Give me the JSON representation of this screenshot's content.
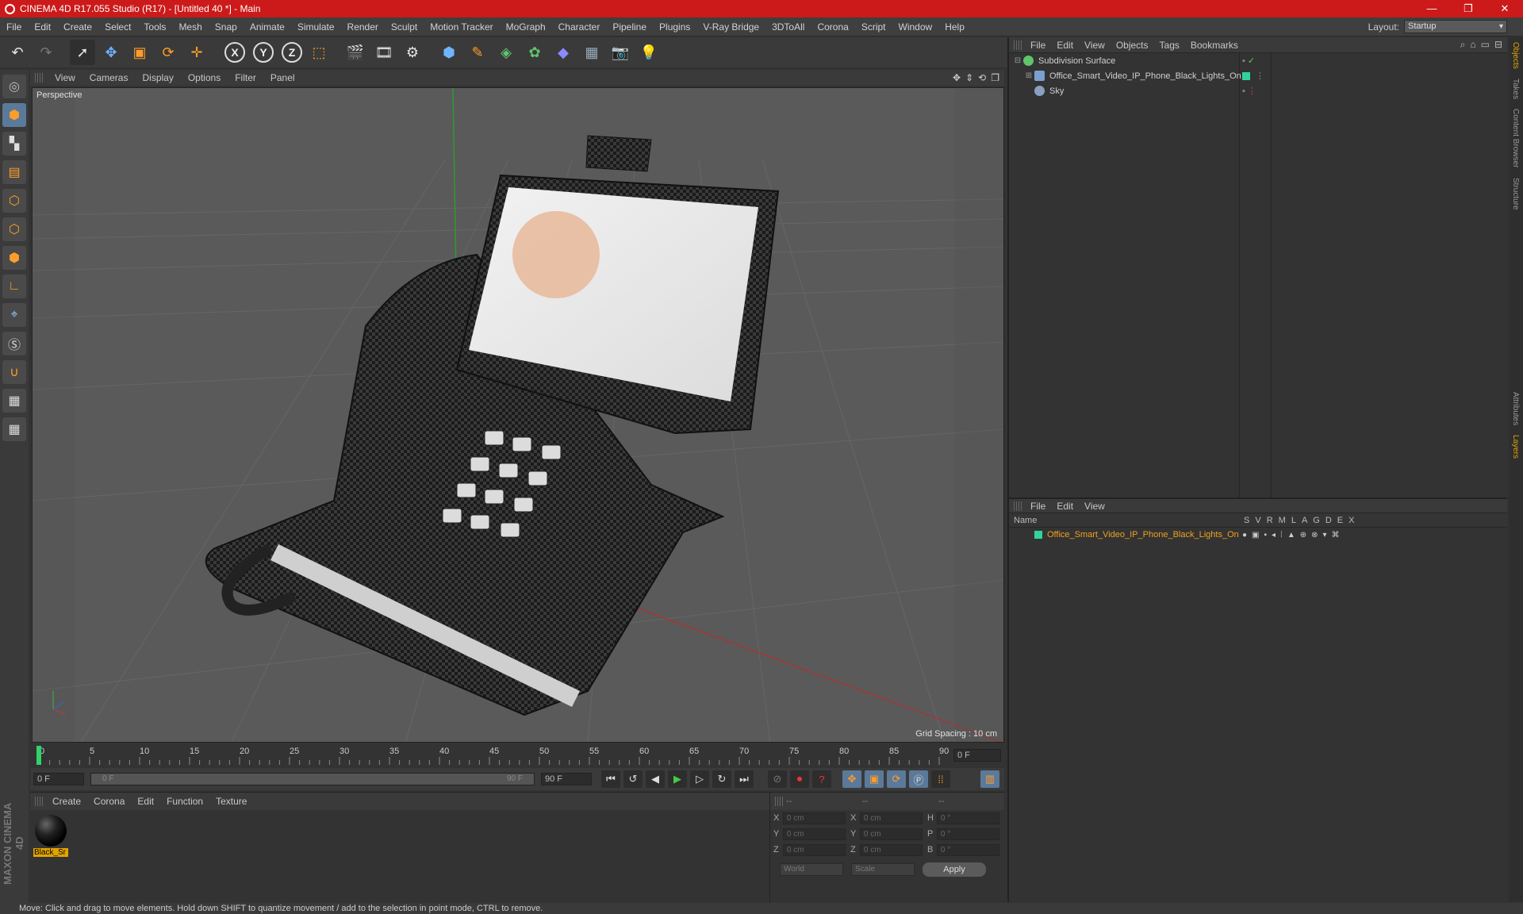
{
  "window": {
    "title": "CINEMA 4D R17.055 Studio (R17) - [Untitled 40 *] - Main",
    "controls": [
      "—",
      "❐",
      "✕"
    ]
  },
  "menu": [
    "File",
    "Edit",
    "Create",
    "Select",
    "Tools",
    "Mesh",
    "Snap",
    "Animate",
    "Simulate",
    "Render",
    "Sculpt",
    "Motion Tracker",
    "MoGraph",
    "Character",
    "Pipeline",
    "Plugins",
    "V-Ray Bridge",
    "3DToAll",
    "Corona",
    "Script",
    "Window",
    "Help"
  ],
  "layout": {
    "label": "Layout:",
    "value": "Startup"
  },
  "toolbar": {
    "axes": [
      "X",
      "Y",
      "Z"
    ]
  },
  "viewport": {
    "menu": [
      "View",
      "Cameras",
      "Display",
      "Options",
      "Filter",
      "Panel"
    ],
    "label": "Perspective",
    "grid_spacing": "Grid Spacing : 10 cm"
  },
  "timeline": {
    "ticks": [
      "0",
      "5",
      "10",
      "15",
      "20",
      "25",
      "30",
      "35",
      "40",
      "45",
      "50",
      "55",
      "60",
      "65",
      "70",
      "75",
      "80",
      "85",
      "90"
    ],
    "end_field": "0 F"
  },
  "transport": {
    "start": "0 F",
    "slider_left": "0 F",
    "slider_right": "90 F",
    "end": "90 F"
  },
  "materials": {
    "menu": [
      "Create",
      "Corona",
      "Edit",
      "Function",
      "Texture"
    ],
    "items": [
      {
        "name": "Black_Sr"
      }
    ]
  },
  "coords": {
    "header": [
      "--",
      "--",
      "--"
    ],
    "rows": [
      {
        "a": "X",
        "av": "0 cm",
        "b": "X",
        "bv": "0 cm",
        "c": "H",
        "cv": "0 °"
      },
      {
        "a": "Y",
        "av": "0 cm",
        "b": "Y",
        "bv": "0 cm",
        "c": "P",
        "cv": "0 °"
      },
      {
        "a": "Z",
        "av": "0 cm",
        "b": "Z",
        "bv": "0 cm",
        "c": "B",
        "cv": "0 °"
      }
    ],
    "world": "World",
    "scale": "Scale",
    "apply": "Apply"
  },
  "objects": {
    "menu": [
      "File",
      "Edit",
      "View",
      "Objects",
      "Tags",
      "Bookmarks"
    ],
    "items": [
      {
        "name": "Subdivision Surface",
        "color": "#5fc46a"
      },
      {
        "name": "Office_Smart_Video_IP_Phone_Black_Lights_On",
        "color": "#7aa0d0"
      },
      {
        "name": "Sky",
        "color": "#8aa0c0"
      }
    ]
  },
  "layers": {
    "menu": [
      "File",
      "Edit",
      "View"
    ],
    "columns": [
      "Name",
      "S",
      "V",
      "R",
      "M",
      "L",
      "A",
      "G",
      "D",
      "E",
      "X"
    ],
    "items": [
      {
        "name": "Office_Smart_Video_IP_Phone_Black_Lights_On",
        "color": "#32d39a"
      }
    ]
  },
  "side_tabs": [
    "Objects",
    "Takes",
    "Content Browser",
    "Structure",
    "Attributes",
    "Layers"
  ],
  "maxon": "MAXON CINEMA 4D",
  "status": "Move: Click and drag to move elements. Hold down SHIFT to quantize movement / add to the selection in point mode, CTRL to remove."
}
